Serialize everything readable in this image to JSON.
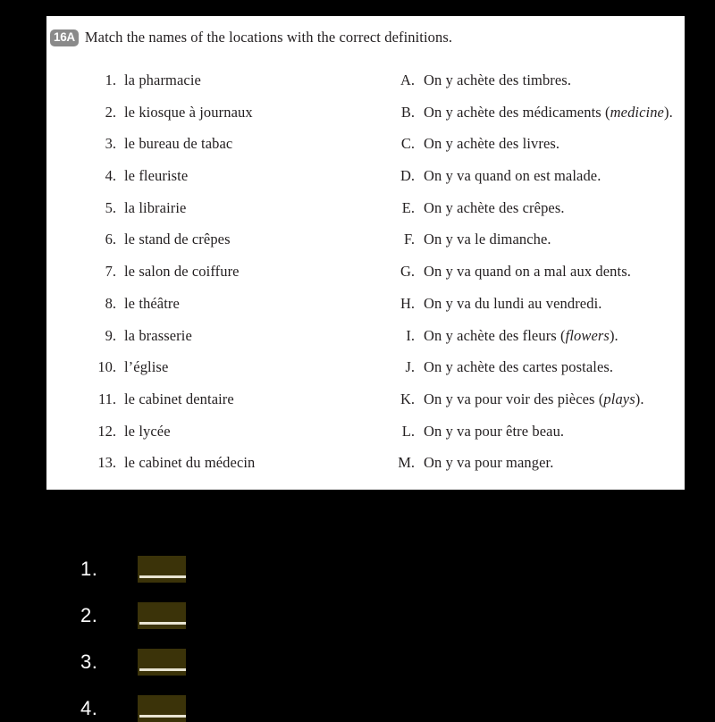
{
  "exercise": {
    "badge": "16A",
    "instruction": "Match the names of the locations with the correct definitions.",
    "locations": [
      {
        "marker": "1.",
        "text": "la pharmacie"
      },
      {
        "marker": "2.",
        "text": "le kiosque à journaux"
      },
      {
        "marker": "3.",
        "text": "le bureau de tabac"
      },
      {
        "marker": "4.",
        "text": "le fleuriste"
      },
      {
        "marker": "5.",
        "text": "la librairie"
      },
      {
        "marker": "6.",
        "text": "le stand de crêpes"
      },
      {
        "marker": "7.",
        "text": "le salon de coiffure"
      },
      {
        "marker": "8.",
        "text": "le théâtre"
      },
      {
        "marker": "9.",
        "text": "la brasserie"
      },
      {
        "marker": "10.",
        "text": "l’église"
      },
      {
        "marker": "11.",
        "text": "le cabinet dentaire"
      },
      {
        "marker": "12.",
        "text": "le lycée"
      },
      {
        "marker": "13.",
        "text": "le cabinet du médecin"
      }
    ],
    "definitions": [
      {
        "marker": "A.",
        "text": "On y achète des timbres.",
        "gloss": ""
      },
      {
        "marker": "B.",
        "text": "On y achète des médicaments ",
        "gloss": "medicine",
        "suffix": ").",
        "prefix_paren": "("
      },
      {
        "marker": "C.",
        "text": "On y achète des livres.",
        "gloss": ""
      },
      {
        "marker": "D.",
        "text": "On y va quand on est malade.",
        "gloss": ""
      },
      {
        "marker": "E.",
        "text": "On y achète des crêpes.",
        "gloss": ""
      },
      {
        "marker": "F.",
        "text": "On y va le dimanche.",
        "gloss": ""
      },
      {
        "marker": "G.",
        "text": "On y va quand on a mal aux dents.",
        "gloss": ""
      },
      {
        "marker": "H.",
        "text": "On y va du lundi au vendredi.",
        "gloss": ""
      },
      {
        "marker": "I.",
        "text": "On y achète des fleurs ",
        "gloss": "flowers",
        "suffix": ").",
        "prefix_paren": "("
      },
      {
        "marker": "J.",
        "text": "On y achète des cartes postales.",
        "gloss": ""
      },
      {
        "marker": "K.",
        "text": "On y va pour voir des pièces ",
        "gloss": "plays",
        "suffix": ").",
        "prefix_paren": "("
      },
      {
        "marker": "L.",
        "text": "On y va pour être beau.",
        "gloss": ""
      },
      {
        "marker": "M.",
        "text": "On y va pour manger.",
        "gloss": ""
      }
    ]
  },
  "answer_sheet": {
    "rows": [
      {
        "number": "1."
      },
      {
        "number": "2."
      },
      {
        "number": "3."
      },
      {
        "number": "4."
      }
    ]
  },
  "colors": {
    "page_background": "#000000",
    "card_background": "#ffffff",
    "text": "#231f20",
    "badge_background": "#8a8a8a",
    "answer_box": "#3b3309",
    "answer_line": "#e8e4d2",
    "answer_number": "#ffffff"
  }
}
